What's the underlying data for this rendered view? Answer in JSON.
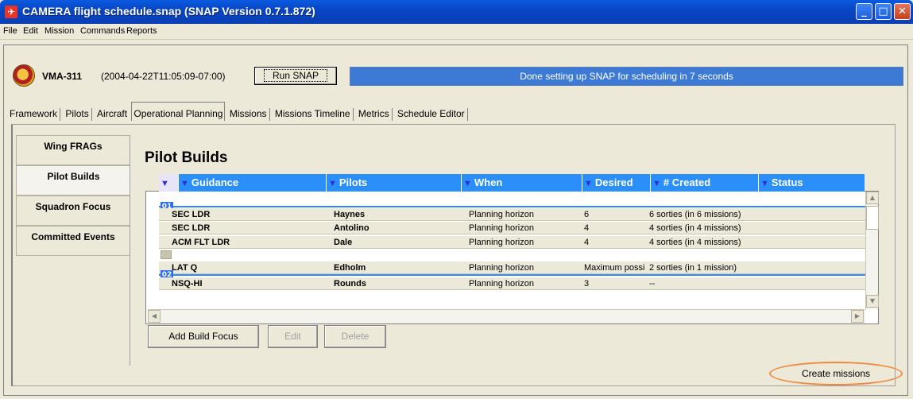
{
  "window": {
    "title": "CAMERA flight schedule.snap (SNAP Version 0.7.1.872)"
  },
  "menu": [
    "File",
    "Edit",
    "Mission",
    "Commands",
    "Reports"
  ],
  "header": {
    "squadron": "VMA-311",
    "date": "(2004-04-22T11:05:09-07:00)",
    "run_button": "Run SNAP",
    "status": "Done setting up SNAP for scheduling in 7 seconds"
  },
  "tabs": [
    "Framework",
    "Pilots",
    "Aircraft",
    "Operational Planning",
    "Missions",
    "Missions Timeline",
    "Metrics",
    "Schedule Editor"
  ],
  "side_tabs": [
    "Wing FRAGs",
    "Pilot Builds",
    "Squadron Focus",
    "Committed Events"
  ],
  "section_title": "Pilot Builds",
  "table": {
    "columns": [
      "Guidance",
      "Pilots",
      "When",
      "Desired",
      "# Created",
      "Status"
    ],
    "groups": [
      "01",
      "02"
    ],
    "rows": [
      {
        "guidance": "SEC LDR",
        "pilots": "Haynes",
        "when": "Planning horizon",
        "desired": "6",
        "created": "6 sorties (in 6 missions)",
        "status": ""
      },
      {
        "guidance": "SEC LDR",
        "pilots": "Antolino",
        "when": "Planning horizon",
        "desired": "4",
        "created": "4 sorties (in 4 missions)",
        "status": ""
      },
      {
        "guidance": "ACM FLT LDR",
        "pilots": "Dale",
        "when": "Planning horizon",
        "desired": "4",
        "created": "4 sorties (in 4 missions)",
        "status": ""
      },
      {
        "guidance": "LAT Q",
        "pilots": "Edholm",
        "when": "Planning horizon",
        "desired": "Maximum possi",
        "created": "2 sorties (in 1 mission)",
        "status": ""
      },
      {
        "guidance": "NSQ-HI",
        "pilots": "Rounds",
        "when": "Planning horizon",
        "desired": "3",
        "created": "--",
        "status": ""
      }
    ]
  },
  "buttons": {
    "add": "Add Build Focus",
    "edit": "Edit",
    "delete": "Delete",
    "create": "Create missions"
  },
  "colors": {
    "accent": "#2b8ffa",
    "status_bar": "#3d7ad6",
    "highlight_circle": "#f08a40"
  }
}
